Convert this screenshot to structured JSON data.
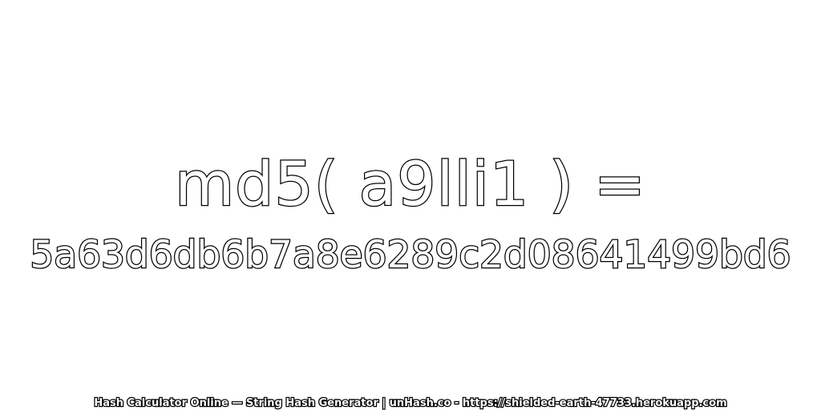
{
  "expression": "md5( a9lli1 ) =",
  "hash_value": "5a63d6db6b7a8e6289c2d08641499bd6",
  "footer": "Hash Calculator Online — String Hash Generator | unHash.co - https://shielded-earth-47733.herokuapp.com",
  "colors": {
    "background": "#ffffff",
    "text_fill": "#ffffff",
    "text_stroke": "#000000"
  }
}
